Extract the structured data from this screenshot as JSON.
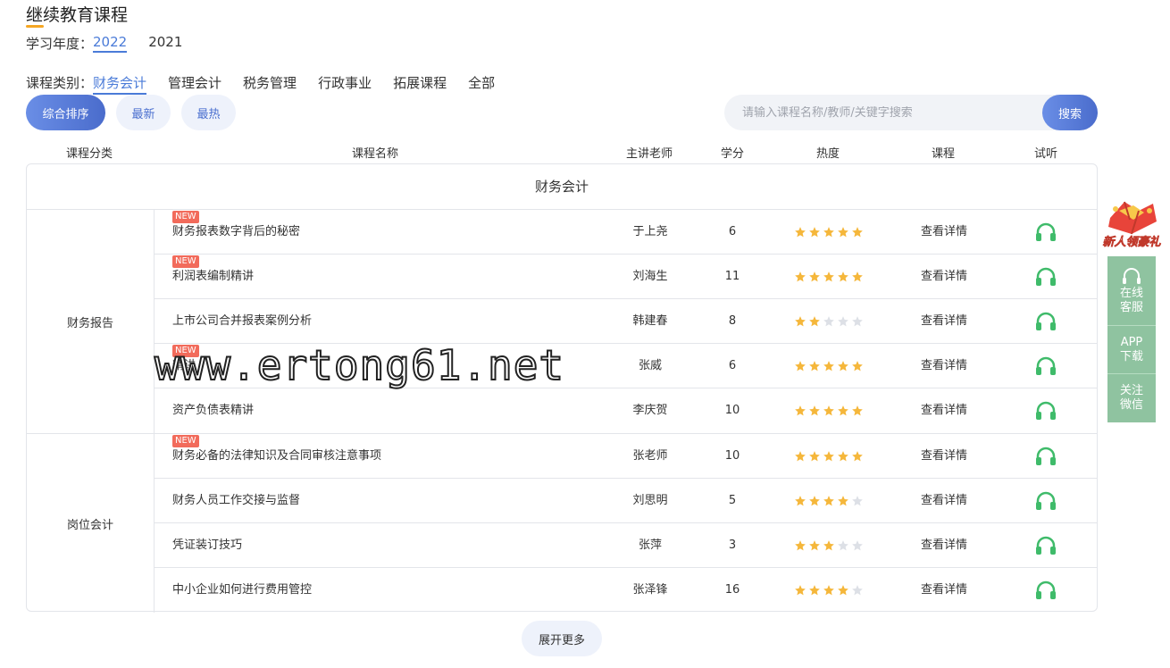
{
  "page": {
    "title": "继续教育课程"
  },
  "year": {
    "label": "学习年度：",
    "options": [
      "2022",
      "2021"
    ],
    "active": 0
  },
  "category": {
    "label": "课程类别：",
    "options": [
      "财务会计",
      "管理会计",
      "税务管理",
      "行政事业",
      "拓展课程",
      "全部"
    ],
    "active": 0
  },
  "sort": {
    "options": [
      "综合排序",
      "最新",
      "最热"
    ]
  },
  "search": {
    "placeholder": "请输入课程名称/教师/关键字搜索",
    "button": "搜索"
  },
  "table": {
    "headers": [
      "课程分类",
      "课程名称",
      "主讲老师",
      "学分",
      "热度",
      "课程",
      "试听"
    ],
    "section_title": "财务会计",
    "groups": [
      {
        "label": "财务报告",
        "rows": [
          {
            "name": "财务报表数字背后的秘密",
            "badge": "NEW",
            "teacher": "于上尧",
            "credit": "6",
            "stars": 5,
            "detail": "查看详情"
          },
          {
            "name": "利润表编制精讲",
            "badge": "NEW",
            "teacher": "刘海生",
            "credit": "11",
            "stars": 5,
            "detail": "查看详情"
          },
          {
            "name": "上市公司合并报表案例分析",
            "badge": "",
            "teacher": "韩建春",
            "credit": "8",
            "stars": 2,
            "detail": "查看详情"
          },
          {
            "name": "精讲",
            "badge": "NEW",
            "teacher": "张威",
            "credit": "6",
            "stars": 5,
            "detail": "查看详情"
          },
          {
            "name": "资产负债表精讲",
            "badge": "",
            "teacher": "李庆贺",
            "credit": "10",
            "stars": 5,
            "detail": "查看详情"
          }
        ]
      },
      {
        "label": "岗位会计",
        "rows": [
          {
            "name": "财务必备的法律知识及合同审核注意事项",
            "badge": "NEW",
            "teacher": "张老师",
            "credit": "10",
            "stars": 5,
            "detail": "查看详情"
          },
          {
            "name": "财务人员工作交接与监督",
            "badge": "",
            "teacher": "刘思明",
            "credit": "5",
            "stars": 4,
            "detail": "查看详情"
          },
          {
            "name": "凭证装订技巧",
            "badge": "",
            "teacher": "张萍",
            "credit": "3",
            "stars": 3,
            "detail": "查看详情"
          },
          {
            "name": "中小企业如何进行费用管控",
            "badge": "",
            "teacher": "张泽锋",
            "credit": "16",
            "stars": 4,
            "detail": "查看详情"
          }
        ]
      }
    ]
  },
  "more": {
    "label": "展开更多"
  },
  "watermark": "www.ertong61.net",
  "gift": {
    "label": "新人领豪礼"
  },
  "side_panel": {
    "items": [
      "在线客服",
      "APP下载",
      "关注微信"
    ]
  },
  "colors": {
    "accent": "#4a7bd8",
    "star_on": "#f5b73b",
    "star_off": "#dde0e6",
    "headphone": "#3fbb6a",
    "side_panel": "#8fc3a0",
    "badge": "#f26b5b"
  },
  "icons": {
    "listen": "headphone-icon",
    "star": "star-icon",
    "service": "headset-icon",
    "gift": "gift-icon"
  }
}
